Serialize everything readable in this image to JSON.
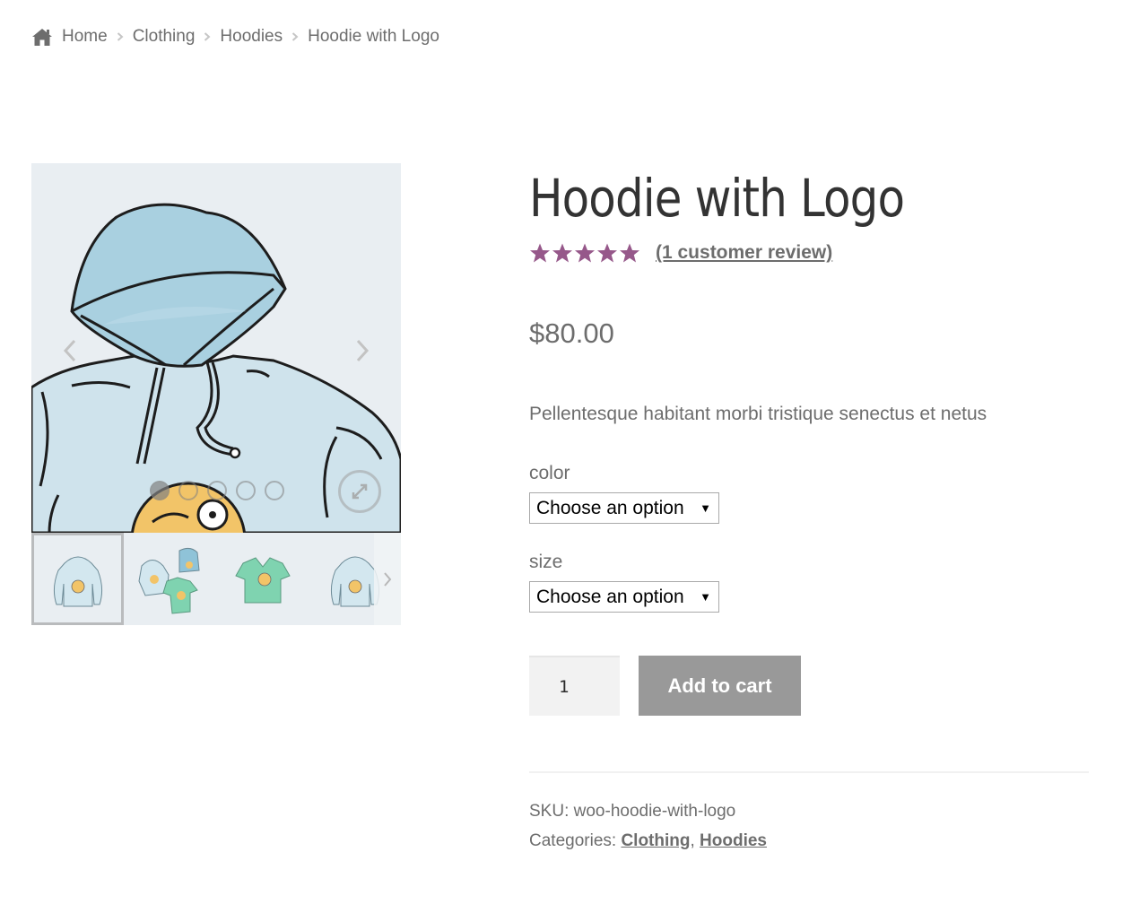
{
  "breadcrumb": {
    "items": [
      "Home",
      "Clothing",
      "Hoodies"
    ],
    "current": "Hoodie with Logo"
  },
  "gallery": {
    "slide_count": 5,
    "active_slide": 1,
    "thumbnails": [
      "hoodie-with-logo",
      "hoodie-beanie-tshirt-group",
      "vneck-tshirt",
      "hoodie-with-logo-alt"
    ]
  },
  "product": {
    "title": "Hoodie with Logo",
    "rating": {
      "value": 5,
      "max": 5
    },
    "review_link": "(1 customer review)",
    "price": "$80.00",
    "description": "Pellentesque habitant morbi tristique senectus et netus",
    "variations": [
      {
        "label": "color",
        "selected": "Choose an option"
      },
      {
        "label": "size",
        "selected": "Choose an option"
      }
    ],
    "quantity": "1",
    "add_to_cart": "Add to cart",
    "meta": {
      "sku_label": "SKU:",
      "sku_value": "woo-hoodie-with-logo",
      "categories_label": "Categories:",
      "categories": [
        "Clothing",
        "Hoodies"
      ],
      "separator": ","
    }
  },
  "colors": {
    "star": "#96588a",
    "button": "#999999",
    "text": "#6d6d6d",
    "title": "#333333"
  }
}
